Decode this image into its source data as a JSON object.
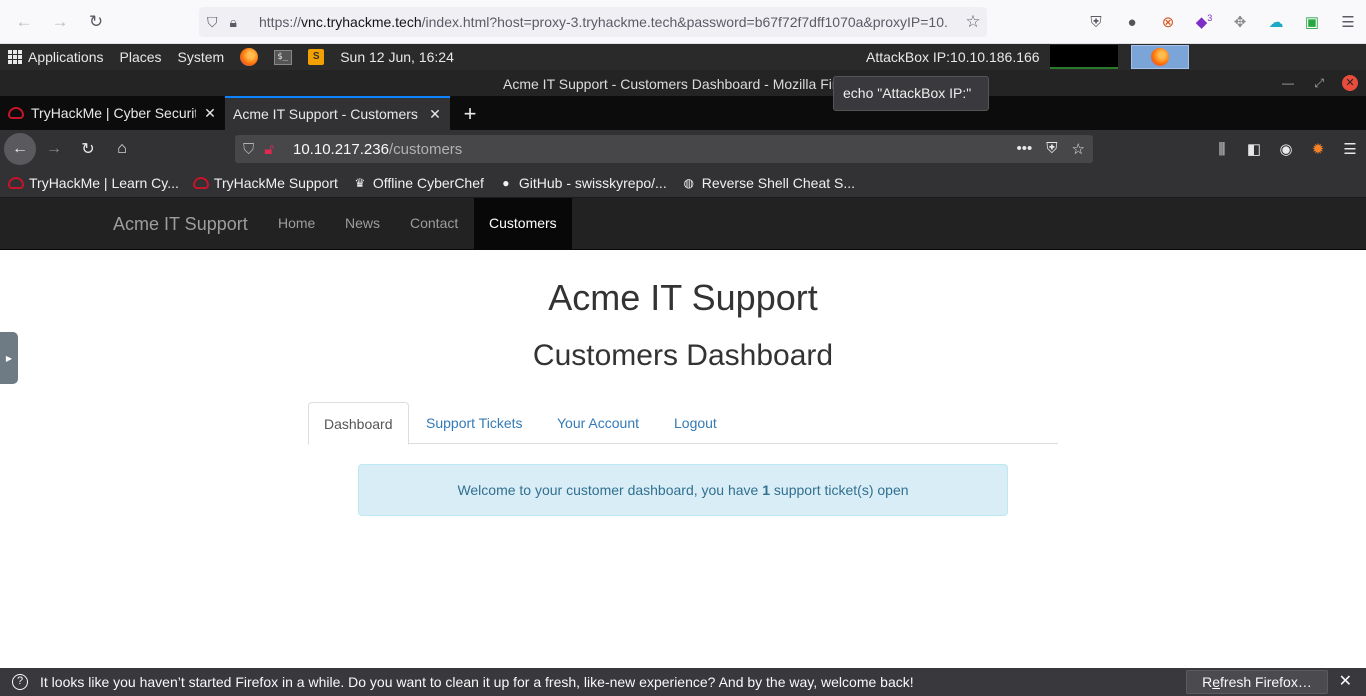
{
  "host_browser": {
    "url_domain": "vnc.tryhackme.tech",
    "url_full_prefix": "https://",
    "url_suffix": "/index.html?host=proxy-3.tryhackme.tech&password=b67f72f7dff1070a&proxyIP=10.",
    "extension_badge": "3"
  },
  "desktop_panel": {
    "applications": "Applications",
    "places": "Places",
    "system": "System",
    "terminal_icon_text": "$_",
    "datetime": "Sun 12 Jun, 16:24",
    "attackbox_ip": "AttackBox IP:10.10.186.166"
  },
  "window": {
    "title": "Acme IT Support - Customers Dashboard - Mozilla Firefox"
  },
  "tooltip": "echo \"AttackBox IP:\"",
  "tabs": [
    {
      "title": "TryHackMe | Cyber Security Training"
    },
    {
      "title": "Acme IT Support - Customers Dashboard"
    }
  ],
  "urlbar": {
    "host": "10.10.217.236",
    "path": "/customers"
  },
  "bookmarks": [
    {
      "label": "TryHackMe | Learn Cy...",
      "icon": "thm-icon"
    },
    {
      "label": "TryHackMe Support",
      "icon": "thm-icon"
    },
    {
      "label": "Offline CyberChef",
      "icon": "chef-icon"
    },
    {
      "label": "GitHub - swisskyrepo/...",
      "icon": "github-icon"
    },
    {
      "label": "Reverse Shell Cheat S...",
      "icon": "globe-icon"
    }
  ],
  "site": {
    "brand": "Acme IT Support",
    "nav": [
      "Home",
      "News",
      "Contact",
      "Customers"
    ],
    "heading": "Acme IT Support",
    "subheading": "Customers Dashboard",
    "tabs": [
      "Dashboard",
      "Support Tickets",
      "Your Account",
      "Logout"
    ],
    "alert_pre": "Welcome to your customer dashboard, you have ",
    "alert_count": "1",
    "alert_post": " support ticket(s) open"
  },
  "notification": {
    "message": "It looks like you haven’t started Firefox in a while. Do you want to clean it up for a fresh, like-new experience? And by the way, welcome back!",
    "button_pre": "R",
    "button_underlined": "e",
    "button_post": "fresh Firefox…"
  }
}
